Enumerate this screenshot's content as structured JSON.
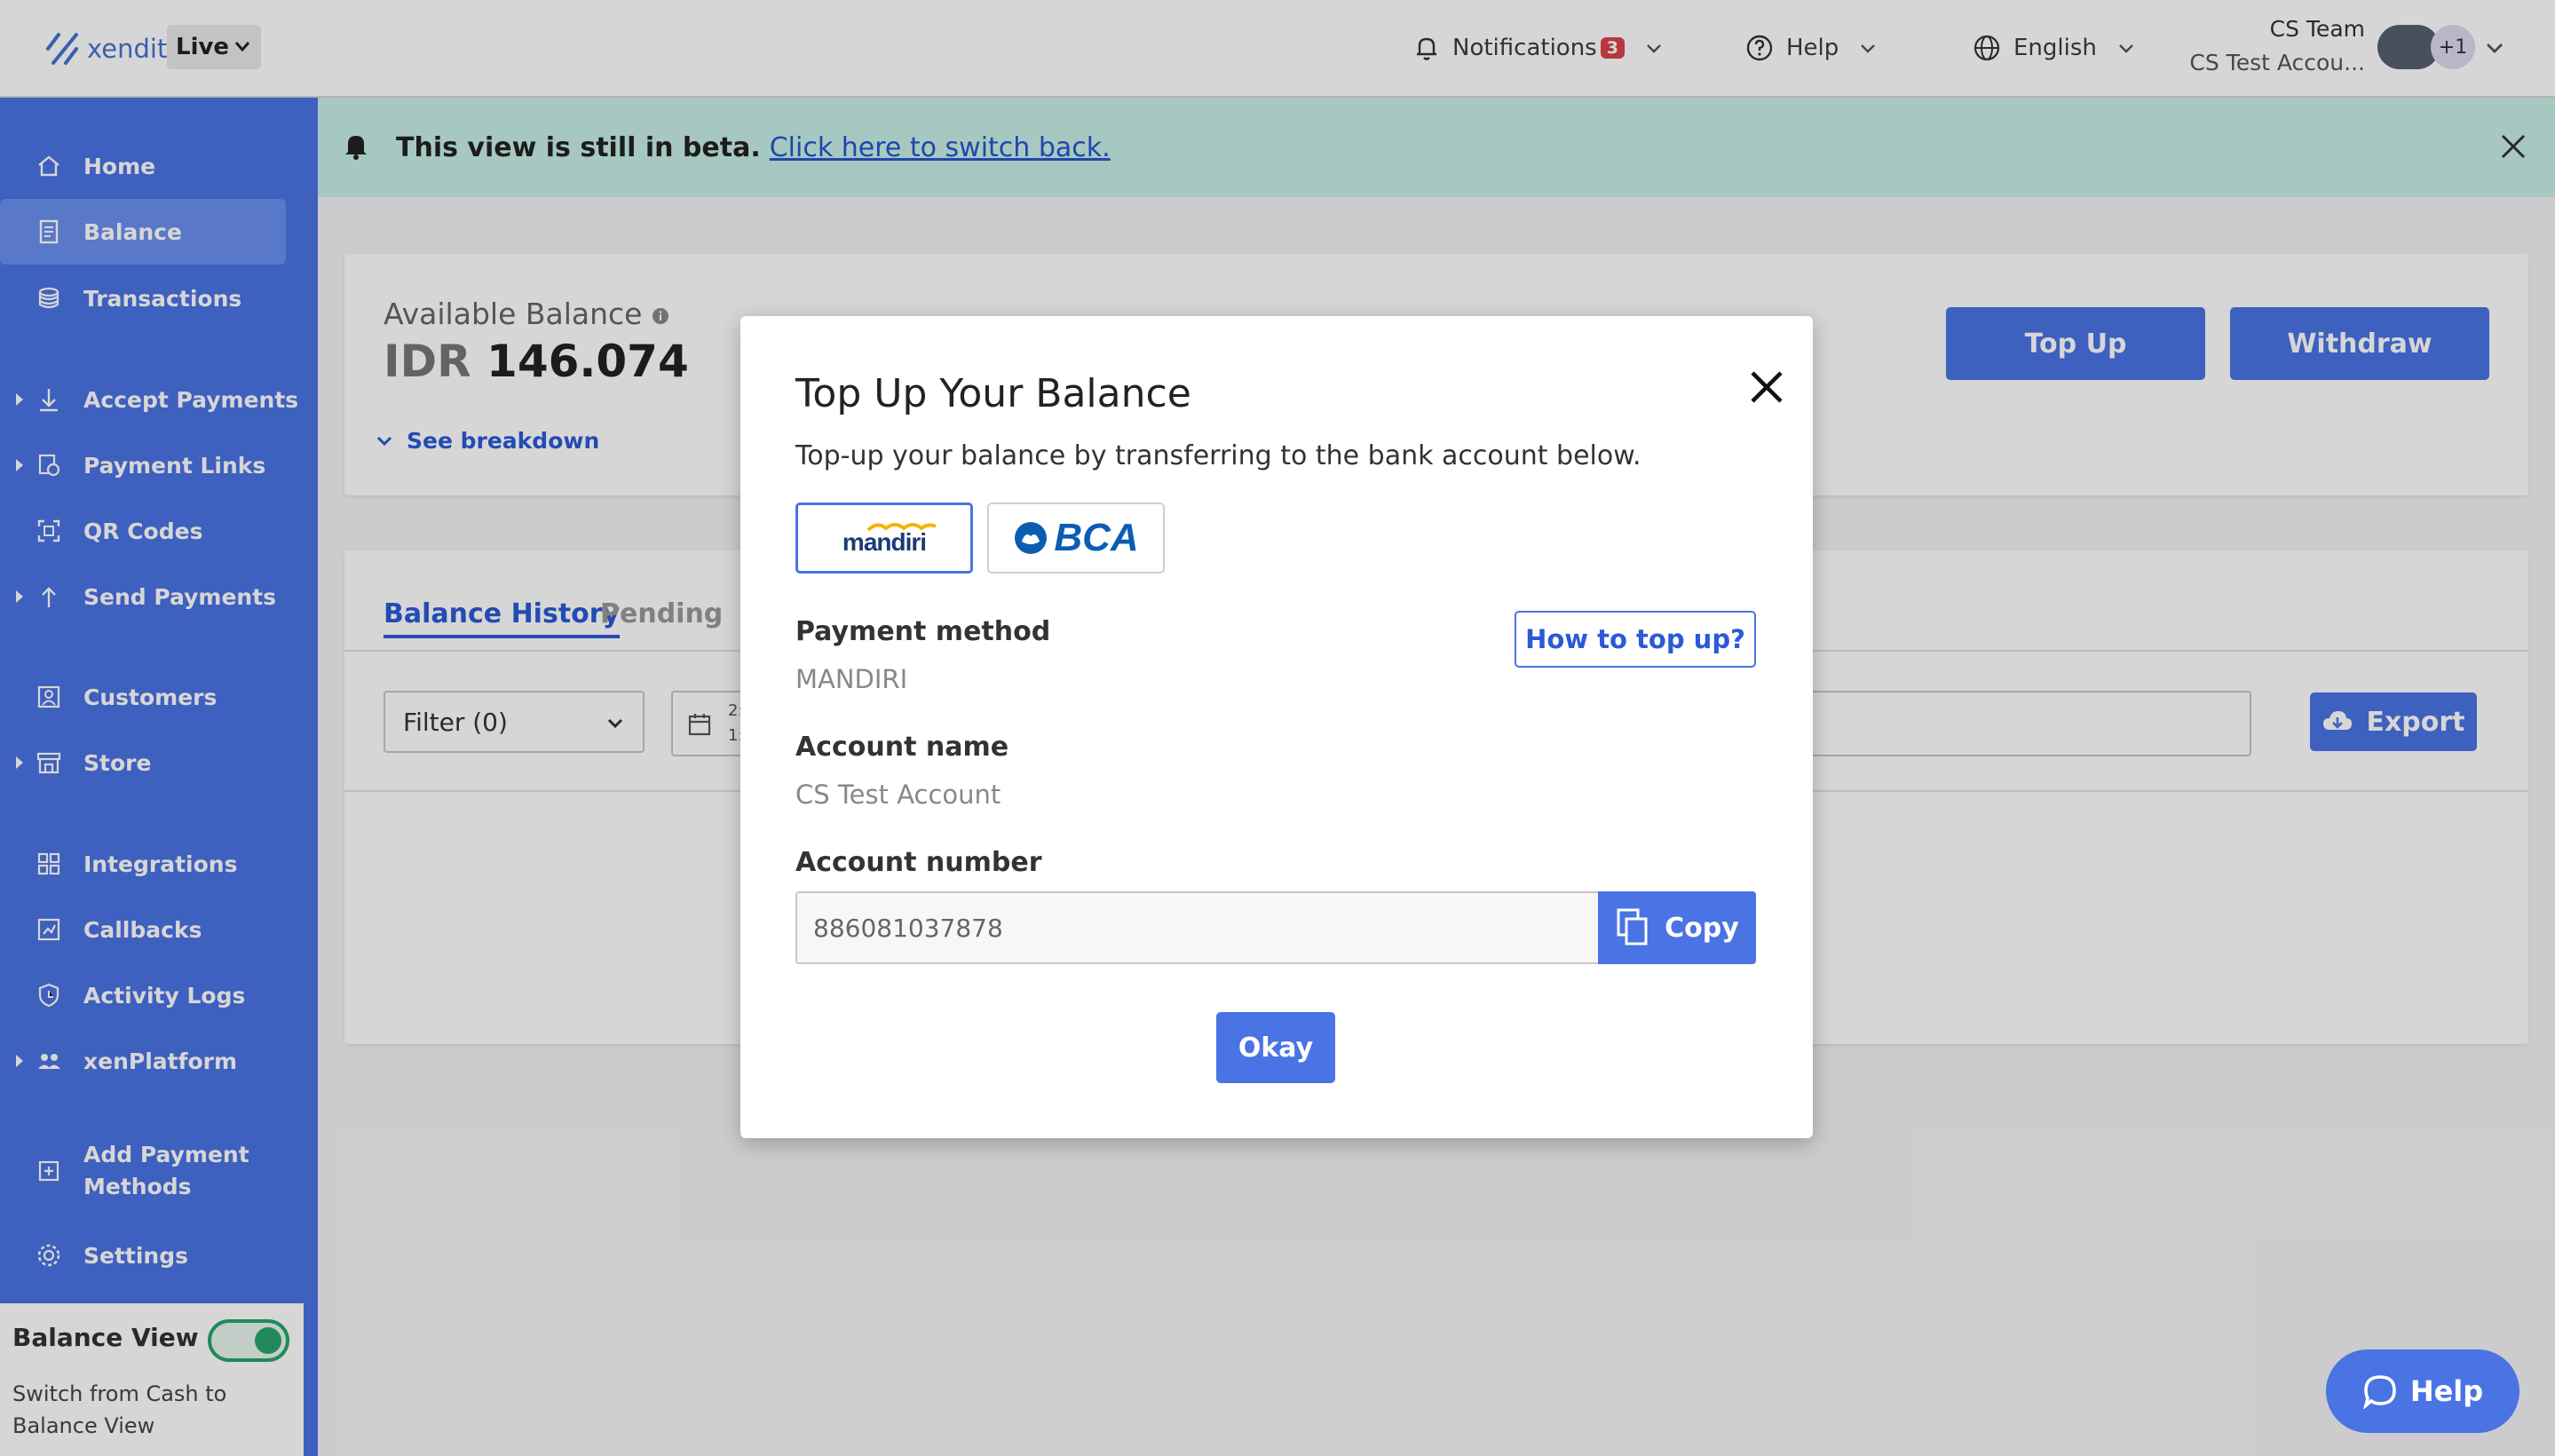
{
  "topbar": {
    "logo_text": "xendit",
    "env": "Live",
    "notifications_label": "Notifications",
    "notifications_count": "3",
    "help_label": "Help",
    "language_label": "English",
    "user_name": "CS Team",
    "account_name": "CS Test Accou...",
    "extra_members": "+1"
  },
  "sidebar": {
    "items": [
      {
        "label": "Home"
      },
      {
        "label": "Balance"
      },
      {
        "label": "Transactions"
      },
      {
        "label": "Accept Payments"
      },
      {
        "label": "Payment Links"
      },
      {
        "label": "QR Codes"
      },
      {
        "label": "Send Payments"
      },
      {
        "label": "Customers"
      },
      {
        "label": "Store"
      },
      {
        "label": "Integrations"
      },
      {
        "label": "Callbacks"
      },
      {
        "label": "Activity Logs"
      },
      {
        "label": "xenPlatform"
      },
      {
        "label": "Add Payment Methods"
      },
      {
        "label": "Settings"
      }
    ],
    "balance_view": {
      "title": "Balance View",
      "description": "Switch from Cash to Balance View",
      "enabled": true
    }
  },
  "beta_banner": {
    "text": "This view is still in beta.",
    "link": "Click here to switch back."
  },
  "balance": {
    "label": "Available Balance",
    "currency": "IDR",
    "amount": "146.074",
    "breakdown_label": "See breakdown",
    "top_up_label": "Top Up",
    "withdraw_label": "Withdraw"
  },
  "history": {
    "tab_history": "Balance History",
    "tab_pending": "Pending",
    "filter_label": "Filter (0)",
    "date_line1": "2:",
    "date_line2": "1:",
    "export_label": "Export"
  },
  "modal": {
    "title": "Top Up Your Balance",
    "description": "Top-up your balance by transferring to the bank account below.",
    "banks": [
      {
        "name": "mandiri",
        "selected": true
      },
      {
        "name": "BCA",
        "selected": false
      }
    ],
    "how_to_label": "How to top up?",
    "payment_method_label": "Payment method",
    "payment_method_value": "MANDIRI",
    "account_name_label": "Account name",
    "account_name_value": "CS Test Account",
    "account_number_label": "Account number",
    "account_number_value": "886081037878",
    "copy_label": "Copy",
    "okay_label": "Okay"
  },
  "help_fab": {
    "label": "Help"
  },
  "colors": {
    "primary": "#4a73e3",
    "sidebar": "#4a73e3",
    "banner": "#c6efe6",
    "badge": "#d9434b",
    "toggle": "#28a46a"
  }
}
